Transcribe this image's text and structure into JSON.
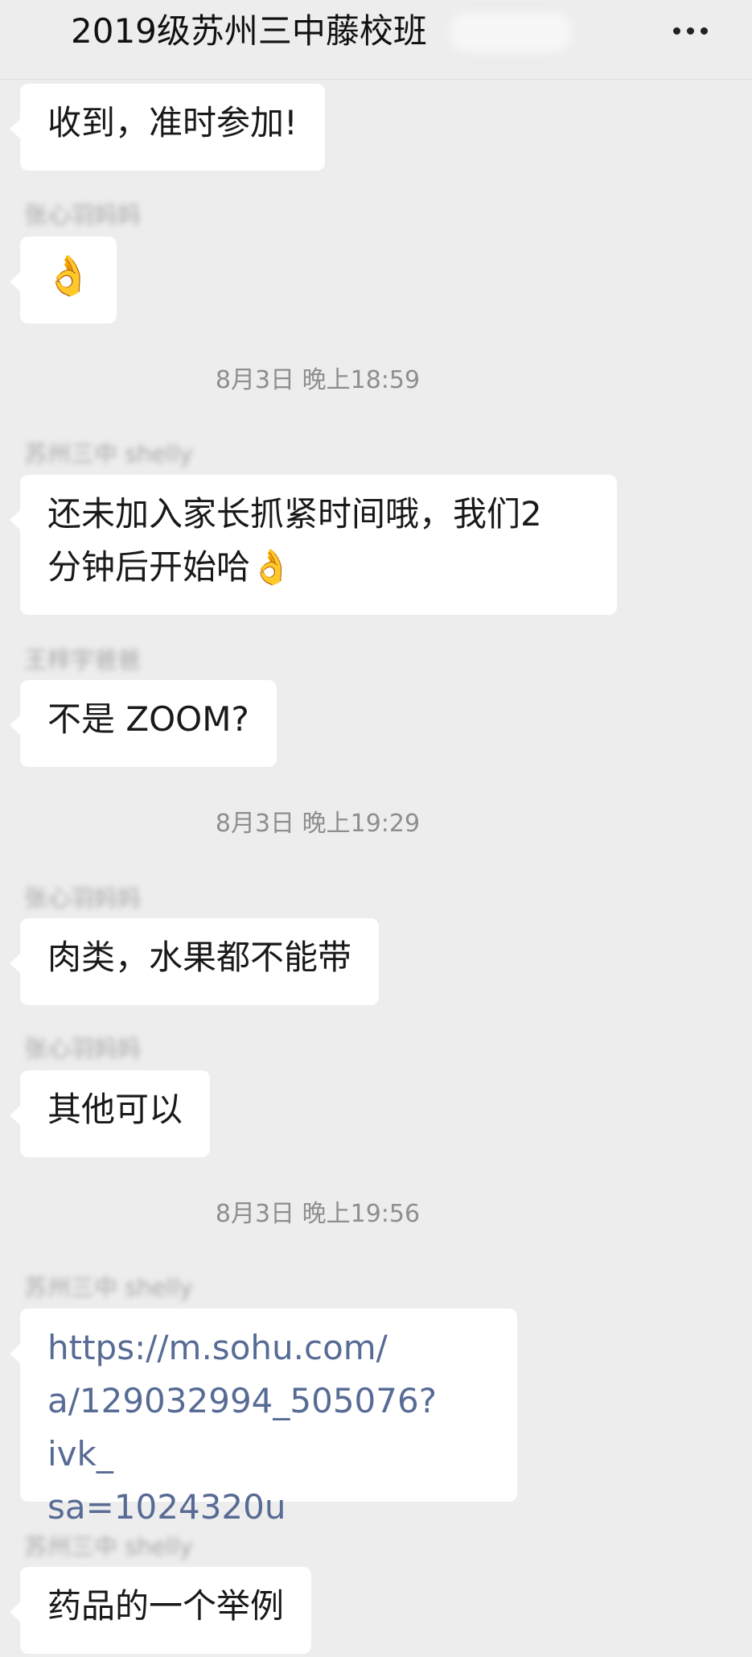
{
  "header": {
    "title": "2019级苏州三中藤校班",
    "more_icon": "more-dots-icon"
  },
  "messages": [
    {
      "type": "text",
      "text": "收到，准时参加!"
    },
    {
      "type": "sender",
      "name": "张心羽妈妈"
    },
    {
      "type": "emoji",
      "text": "👌"
    },
    {
      "type": "time",
      "text": "8月3日 晚上18:59"
    },
    {
      "type": "sender",
      "name": "苏州三中 shelly"
    },
    {
      "type": "text",
      "line1": "还未加入家长抓紧时间哦，我们2",
      "line2": "分钟后开始哈👌"
    },
    {
      "type": "sender",
      "name": "王梓宇爸爸"
    },
    {
      "type": "text",
      "text": "不是 ZOOM?"
    },
    {
      "type": "time",
      "text": "8月3日 晚上19:29"
    },
    {
      "type": "sender",
      "name": "张心羽妈妈"
    },
    {
      "type": "text",
      "text": "肉类，水果都不能带"
    },
    {
      "type": "sender",
      "name": "张心羽妈妈"
    },
    {
      "type": "text",
      "text": "其他可以"
    },
    {
      "type": "time",
      "text": "8月3日 晚上19:56"
    },
    {
      "type": "sender",
      "name": "苏州三中 shelly"
    },
    {
      "type": "link",
      "line1": "https://m.sohu.com/",
      "line2": "a/129032994_505076?ivk_",
      "line3": "sa=1024320u"
    },
    {
      "type": "sender",
      "name": "苏州三中 shelly"
    },
    {
      "type": "text",
      "text": "药品的一个举例"
    }
  ],
  "colors": {
    "background": "#ededed",
    "bubble": "#ffffff",
    "link": "#576b95",
    "timestamp": "#8e8e8e"
  }
}
